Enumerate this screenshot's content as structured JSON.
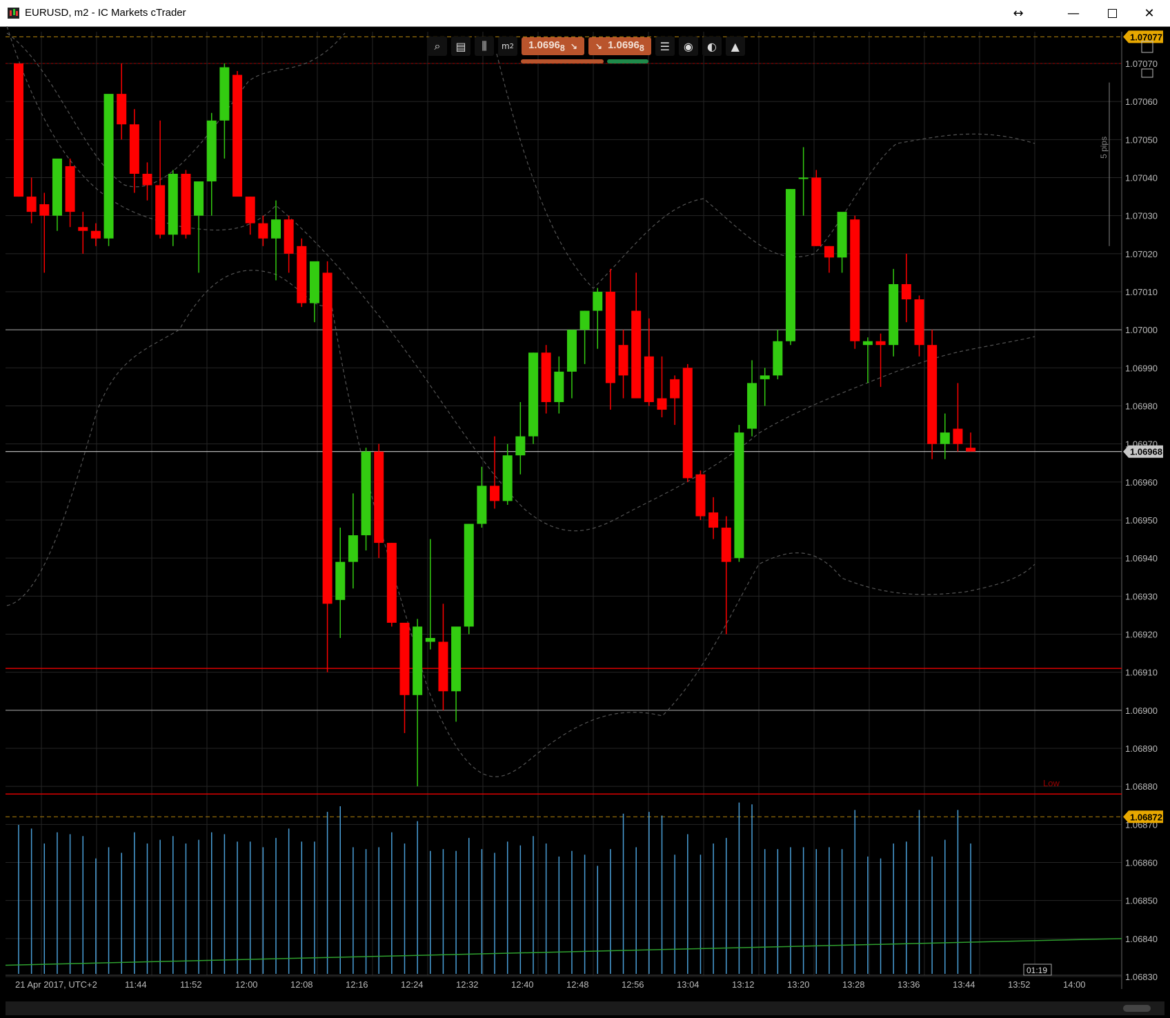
{
  "window": {
    "title": "EURUSD, m2 - IC Markets cTrader",
    "resize_icon": "resize-horizontal-icon",
    "minimize_icon": "minimize-icon",
    "maximize_icon": "maximize-icon",
    "close_icon": "close-icon"
  },
  "toolbar": {
    "icons": [
      "zoom-icon",
      "chart-settings-icon",
      "chart-type-icon",
      "timeframe-icon",
      "list-icon",
      "settings-icon",
      "objects-icon",
      "trade-icon"
    ],
    "timeframe_label": "m",
    "timeframe_sub": "2",
    "sell_price": "1.0696",
    "sell_price_sub": "8",
    "buy_price": "1.0696",
    "buy_price_sub": "8"
  },
  "right_panel": {
    "price_top": "1.07077",
    "price_current": "1.06968",
    "price_low": "1.06872",
    "pip_scale": "5 pips",
    "low_label": "Low",
    "countdown": "01:19"
  },
  "colors": {
    "bull": "#33cc11",
    "bear": "#ff0000",
    "volume": "#4a9fd8",
    "ma_line": "#2ea02e",
    "grid": "#262626",
    "marker_top_low": "#e8a800",
    "current": "#c8c8c8"
  },
  "chart_data": {
    "type": "candlestick",
    "symbol": "EURUSD",
    "timeframe": "m2",
    "y_ticks": [
      "1.07070",
      "1.07060",
      "1.07050",
      "1.07040",
      "1.07030",
      "1.07020",
      "1.07010",
      "1.07000",
      "1.06990",
      "1.06980",
      "1.06970",
      "1.06960",
      "1.06950",
      "1.06940",
      "1.06930",
      "1.06920",
      "1.06910",
      "1.06900",
      "1.06890",
      "1.06880",
      "1.06870",
      "1.06860",
      "1.06850",
      "1.06840",
      "1.06830"
    ],
    "x_ticks": [
      "21 Apr 2017, UTC+2",
      "11:44",
      "11:52",
      "12:00",
      "12:08",
      "12:16",
      "12:24",
      "12:32",
      "12:40",
      "12:48",
      "12:56",
      "13:04",
      "13:12",
      "13:20",
      "13:28",
      "13:36",
      "13:44",
      "13:52",
      "14:00"
    ],
    "ylim": [
      1.06827,
      1.07085
    ],
    "candles": [
      [
        1.0707,
        1.0707,
        1.07035,
        1.07035
      ],
      [
        1.07035,
        1.0704,
        1.07028,
        1.07031
      ],
      [
        1.07033,
        1.07036,
        1.07015,
        1.0703
      ],
      [
        1.0703,
        1.0704,
        1.07026,
        1.07045
      ],
      [
        1.07043,
        1.07045,
        1.07027,
        1.07031
      ],
      [
        1.07027,
        1.07031,
        1.0702,
        1.07026
      ],
      [
        1.07026,
        1.07028,
        1.07022,
        1.07024
      ],
      [
        1.07024,
        1.07059,
        1.07022,
        1.07062
      ],
      [
        1.07062,
        1.0707,
        1.0705,
        1.07054
      ],
      [
        1.07054,
        1.07058,
        1.07036,
        1.07041
      ],
      [
        1.07041,
        1.07044,
        1.07034,
        1.07038
      ],
      [
        1.07038,
        1.07055,
        1.07024,
        1.07025
      ],
      [
        1.07025,
        1.07042,
        1.07022,
        1.07041
      ],
      [
        1.07041,
        1.07042,
        1.07024,
        1.07025
      ],
      [
        1.0703,
        1.0703,
        1.07015,
        1.07039
      ],
      [
        1.07039,
        1.07057,
        1.0703,
        1.07055
      ],
      [
        1.07055,
        1.0707,
        1.07045,
        1.07069
      ],
      [
        1.07067,
        1.07068,
        1.0704,
        1.07035
      ],
      [
        1.07035,
        1.07035,
        1.07025,
        1.07028
      ],
      [
        1.07028,
        1.0703,
        1.07022,
        1.07024
      ],
      [
        1.07024,
        1.07034,
        1.07013,
        1.07029
      ],
      [
        1.07029,
        1.0703,
        1.07015,
        1.0702
      ],
      [
        1.07022,
        1.07024,
        1.07006,
        1.07007
      ],
      [
        1.07007,
        1.07017,
        1.07002,
        1.07018
      ],
      [
        1.07015,
        1.07018,
        1.0691,
        1.06928
      ],
      [
        1.06929,
        1.06948,
        1.06919,
        1.06939
      ],
      [
        1.06939,
        1.06957,
        1.06932,
        1.06946
      ],
      [
        1.06946,
        1.06969,
        1.06942,
        1.06968
      ],
      [
        1.06968,
        1.0697,
        1.0694,
        1.06944
      ],
      [
        1.06944,
        1.06944,
        1.06922,
        1.06923
      ],
      [
        1.06923,
        1.06923,
        1.06894,
        1.06904
      ],
      [
        1.06904,
        1.06924,
        1.0688,
        1.06922
      ],
      [
        1.06918,
        1.06945,
        1.06916,
        1.06919
      ],
      [
        1.06918,
        1.06928,
        1.069,
        1.06905
      ],
      [
        1.06905,
        1.06922,
        1.06897,
        1.06922
      ],
      [
        1.06922,
        1.06949,
        1.0692,
        1.06949
      ],
      [
        1.06949,
        1.06964,
        1.06948,
        1.06959
      ],
      [
        1.06959,
        1.06972,
        1.06953,
        1.06955
      ],
      [
        1.06955,
        1.0697,
        1.06954,
        1.06967
      ],
      [
        1.06967,
        1.06981,
        1.06962,
        1.06972
      ],
      [
        1.06972,
        1.06994,
        1.0697,
        1.06994
      ],
      [
        1.06994,
        1.06996,
        1.06978,
        1.06981
      ],
      [
        1.06981,
        1.06993,
        1.06978,
        1.06989
      ],
      [
        1.06989,
        1.07,
        1.06982,
        1.07
      ],
      [
        1.07,
        1.07005,
        1.06991,
        1.07005
      ],
      [
        1.07005,
        1.07011,
        1.06995,
        1.0701
      ],
      [
        1.0701,
        1.07016,
        1.06979,
        1.06986
      ],
      [
        1.06996,
        1.07,
        1.06982,
        1.06988
      ],
      [
        1.07005,
        1.07015,
        1.06986,
        1.06982
      ],
      [
        1.06993,
        1.07003,
        1.0698,
        1.06981
      ],
      [
        1.06982,
        1.06993,
        1.06977,
        1.06979
      ],
      [
        1.06987,
        1.06988,
        1.06975,
        1.06982
      ],
      [
        1.0699,
        1.06991,
        1.0696,
        1.06961
      ],
      [
        1.06962,
        1.06963,
        1.0695,
        1.06951
      ],
      [
        1.06952,
        1.06956,
        1.06945,
        1.06948
      ],
      [
        1.06948,
        1.06951,
        1.0692,
        1.06939
      ],
      [
        1.0694,
        1.06975,
        1.06939,
        1.06973
      ],
      [
        1.06974,
        1.06992,
        1.06972,
        1.06986
      ],
      [
        1.06987,
        1.0699,
        1.0698,
        1.06988
      ],
      [
        1.06988,
        1.07,
        1.06987,
        1.06997
      ],
      [
        1.06997,
        1.07037,
        1.06996,
        1.07037
      ],
      [
        1.0704,
        1.07048,
        1.0703,
        1.0704
      ],
      [
        1.0704,
        1.07042,
        1.07022,
        1.07022
      ],
      [
        1.07022,
        1.07022,
        1.07015,
        1.07019
      ],
      [
        1.07019,
        1.0703,
        1.07015,
        1.07031
      ],
      [
        1.07029,
        1.0703,
        1.06995,
        1.06997
      ],
      [
        1.06996,
        1.06998,
        1.06986,
        1.06997
      ],
      [
        1.06997,
        1.06999,
        1.06985,
        1.06996
      ],
      [
        1.06996,
        1.07016,
        1.06993,
        1.07012
      ],
      [
        1.07012,
        1.0702,
        1.07002,
        1.07008
      ],
      [
        1.07008,
        1.07009,
        1.06993,
        1.06996
      ],
      [
        1.06996,
        1.07,
        1.06966,
        1.0697
      ],
      [
        1.0697,
        1.06978,
        1.06966,
        1.06973
      ],
      [
        1.06974,
        1.06986,
        1.06968,
        1.0697
      ],
      [
        1.06969,
        1.06973,
        1.06968,
        1.06968
      ]
    ],
    "volumes": [
      80,
      78,
      70,
      76,
      75,
      74,
      62,
      68,
      65,
      76,
      70,
      72,
      74,
      70,
      72,
      76,
      75,
      71,
      71,
      68,
      73,
      78,
      71,
      71,
      87,
      90,
      68,
      67,
      68,
      76,
      70,
      82,
      66,
      67,
      66,
      73,
      67,
      65,
      71,
      69,
      74,
      70,
      63,
      66,
      64,
      58,
      67,
      86,
      68,
      87,
      85,
      64,
      75,
      64,
      70,
      73,
      92,
      91,
      67,
      67,
      68,
      68,
      67,
      68,
      67,
      88,
      63,
      62,
      70,
      71,
      88,
      63,
      72,
      88,
      70
    ],
    "ma_line": [
      1.06833,
      1.0684
    ],
    "h_lines": [
      {
        "y": 1.0707,
        "kind": "red-dotted"
      },
      {
        "y": 1.07,
        "kind": "gray"
      },
      {
        "y": 1.06968,
        "kind": "current"
      },
      {
        "y": 1.06911,
        "kind": "red"
      },
      {
        "y": 1.069,
        "kind": "gray"
      },
      {
        "y": 1.06878,
        "kind": "red"
      },
      {
        "y": 1.06872,
        "kind": "orange-dashed"
      },
      {
        "y": 1.07077,
        "kind": "orange-dashed"
      }
    ]
  }
}
